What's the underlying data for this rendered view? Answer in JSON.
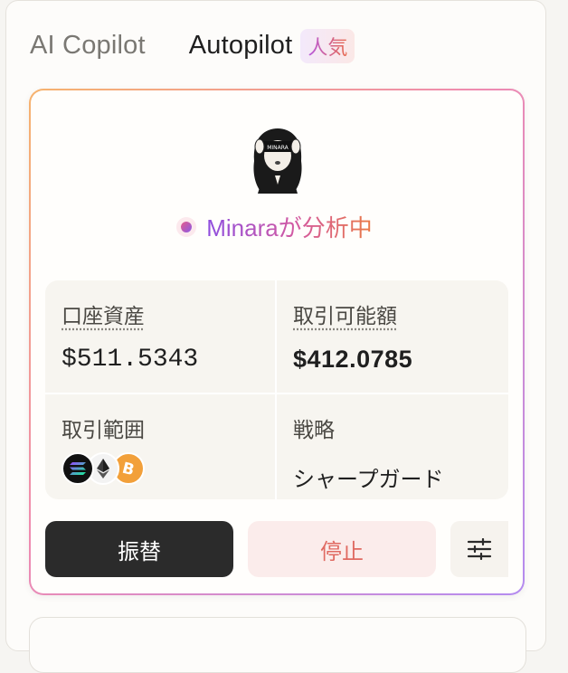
{
  "tabs": {
    "ai_copilot": "AI Copilot",
    "autopilot": "Autopilot",
    "popular_badge": "人気"
  },
  "status": {
    "text": "Minaraが分析中",
    "avatar_text": "MINARA"
  },
  "stats": {
    "account_assets": {
      "label": "口座資産",
      "value": "$511.5343"
    },
    "tradable_amount": {
      "label": "取引可能額",
      "value": "$412.0785"
    },
    "trading_range": {
      "label": "取引範囲",
      "coins": [
        "SOL",
        "ETH",
        "BTC"
      ]
    },
    "strategy": {
      "label": "戦略",
      "value": "シャープガード"
    }
  },
  "buttons": {
    "transfer": "振替",
    "stop": "停止",
    "settings_icon": "sliders-icon"
  },
  "colors": {
    "accent_gradient_start": "#8e4ee0",
    "accent_gradient_end": "#ea7a45",
    "stop_text": "#e06a62",
    "dark_button": "#2b2b2b"
  }
}
